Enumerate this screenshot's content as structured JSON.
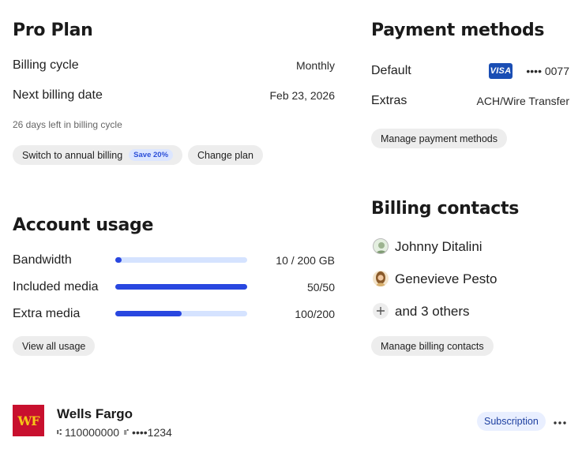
{
  "pro_plan": {
    "title": "Pro Plan",
    "rows": [
      {
        "label": "Billing cycle",
        "value": "Monthly"
      },
      {
        "label": "Next billing date",
        "value": "Feb 23, 2026"
      }
    ],
    "days_left": "26 days left in billing cycle",
    "switch_label": "Switch to annual billing",
    "save_badge": "Save 20%",
    "change_plan_label": "Change plan"
  },
  "account_usage": {
    "title": "Account usage",
    "items": [
      {
        "label": "Bandwidth",
        "value": "10 / 200 GB",
        "fraction": 0.05
      },
      {
        "label": "Included media",
        "value": "50/50",
        "fraction": 1.0
      },
      {
        "label": "Extra media",
        "value": "100/200",
        "fraction": 0.5
      }
    ],
    "view_all_label": "View all usage",
    "colors": {
      "track": "#d5e3ff",
      "fill": "#2947e0"
    }
  },
  "payment_methods": {
    "title": "Payment methods",
    "default_label": "Default",
    "card_brand": "VISA",
    "card_number": "•••• 0077",
    "extras_label": "Extras",
    "extras_value": "ACH/Wire Transfer",
    "manage_label": "Manage payment methods"
  },
  "billing_contacts": {
    "title": "Billing contacts",
    "contacts": [
      "Johnny Ditalini",
      "Genevieve Pesto"
    ],
    "others": "and 3 others",
    "manage_label": "Manage billing contacts"
  },
  "bank": {
    "logo_text": "WF",
    "name": "Wells Fargo",
    "routing": "110000000",
    "account": "••••1234",
    "badge": "Subscription",
    "more_icon": "more-horizontal-icon"
  }
}
